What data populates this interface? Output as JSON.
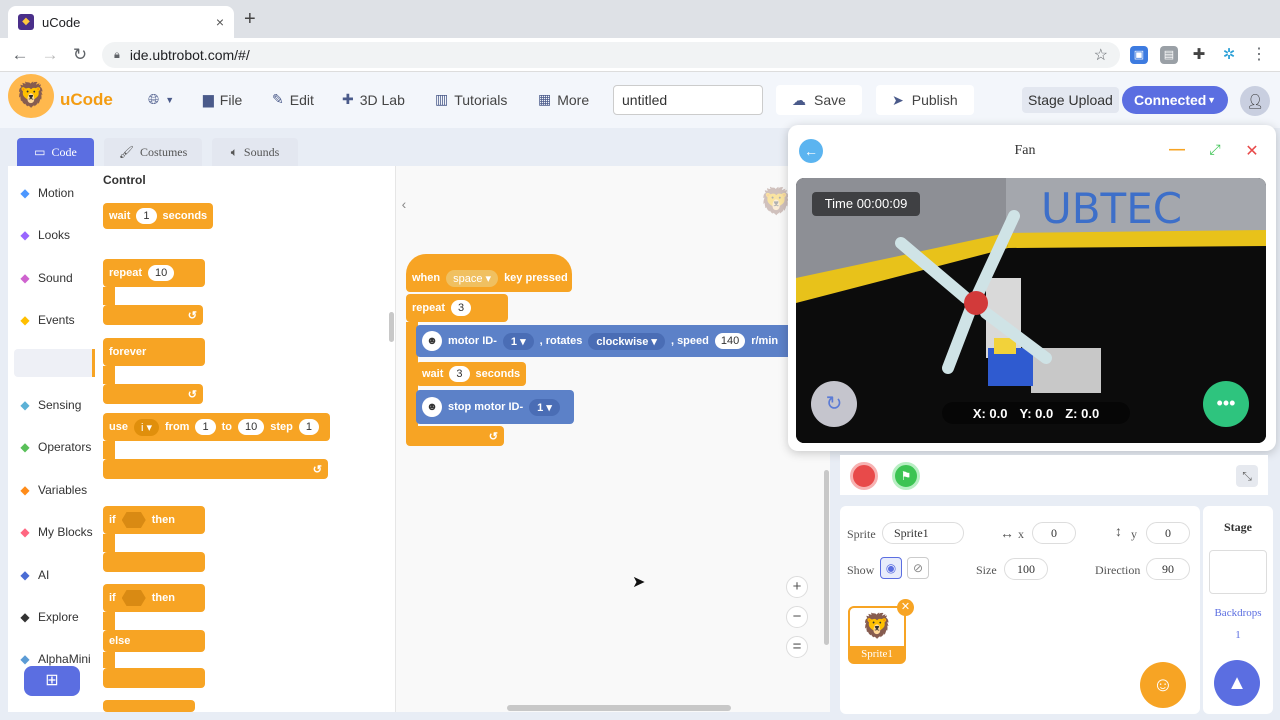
{
  "browser": {
    "tab_title": "uCode",
    "tab_close": "×",
    "new_tab": "+",
    "url": "ide.ubtrobot.com/#/"
  },
  "header": {
    "brand": "uCode",
    "menu": {
      "language_icon": "globe-icon",
      "file": "File",
      "edit": "Edit",
      "lab": "3D Lab",
      "tutorials": "Tutorials",
      "more": "More"
    },
    "project_title": "untitled",
    "save": "Save",
    "publish": "Publish",
    "stage_upload": "Stage Upload",
    "connected": "Connected"
  },
  "editor_tabs": {
    "code": "Code",
    "costumes": "Costumes",
    "sounds": "Sounds"
  },
  "categories": [
    {
      "label": "Motion",
      "color": "#4c97ff"
    },
    {
      "label": "Looks",
      "color": "#9966ff"
    },
    {
      "label": "Sound",
      "color": "#cf63cf"
    },
    {
      "label": "Events",
      "color": "#ffbf00"
    },
    {
      "label": "Control",
      "color": "#ffab19"
    },
    {
      "label": "Sensing",
      "color": "#5cb1d6"
    },
    {
      "label": "Operators",
      "color": "#59c059"
    },
    {
      "label": "Variables",
      "color": "#ff8c1a"
    },
    {
      "label": "My Blocks",
      "color": "#ff6680"
    },
    {
      "label": "AI",
      "color": "#4a6cd4"
    },
    {
      "label": "Explore",
      "color": "#333333"
    },
    {
      "label": "AlphaMini",
      "color": "#5b9bd5"
    }
  ],
  "palette": {
    "title": "Control",
    "wait": {
      "text1": "wait",
      "value": "1",
      "text2": "seconds"
    },
    "repeat": {
      "text": "repeat",
      "value": "10"
    },
    "forever": "forever",
    "use": {
      "text": "use",
      "var": "i",
      "from": "from",
      "from_val": "1",
      "to": "to",
      "to_val": "10",
      "step": "step",
      "step_val": "1"
    },
    "if_then": {
      "if": "if",
      "then": "then"
    },
    "if_else": {
      "if": "if",
      "then": "then",
      "else": "else"
    }
  },
  "script": {
    "when": "when",
    "key": "space",
    "key_pressed": "key pressed",
    "repeat": "repeat",
    "repeat_val": "3",
    "motor_label": "motor ID-",
    "motor_id": "1",
    "rotates": ", rotates",
    "direction": "clockwise",
    "speed_label": ", speed",
    "speed_val": "140",
    "unit": "r/min",
    "wait": "wait",
    "wait_val": "3",
    "seconds": "seconds",
    "stop_label": "stop motor ID-",
    "stop_id": "1"
  },
  "zoom": {
    "in": "+",
    "out": "−",
    "reset": "="
  },
  "simulator": {
    "title": "Fan",
    "time": "Time 00:00:09",
    "x": "X: 0.0",
    "y": "Y: 0.0",
    "z": "Z: 0.0",
    "wall_text": "UBTEC"
  },
  "sprite": {
    "sprite_label": "Sprite",
    "name": "Sprite1",
    "x_label": "x",
    "x": "0",
    "y_label": "y",
    "y": "0",
    "show_label": "Show",
    "size_label": "Size",
    "size": "100",
    "direction_label": "Direction",
    "direction": "90",
    "card_name": "Sprite1"
  },
  "stage": {
    "label": "Stage",
    "backdrops": "Backdrops",
    "count": "1"
  }
}
